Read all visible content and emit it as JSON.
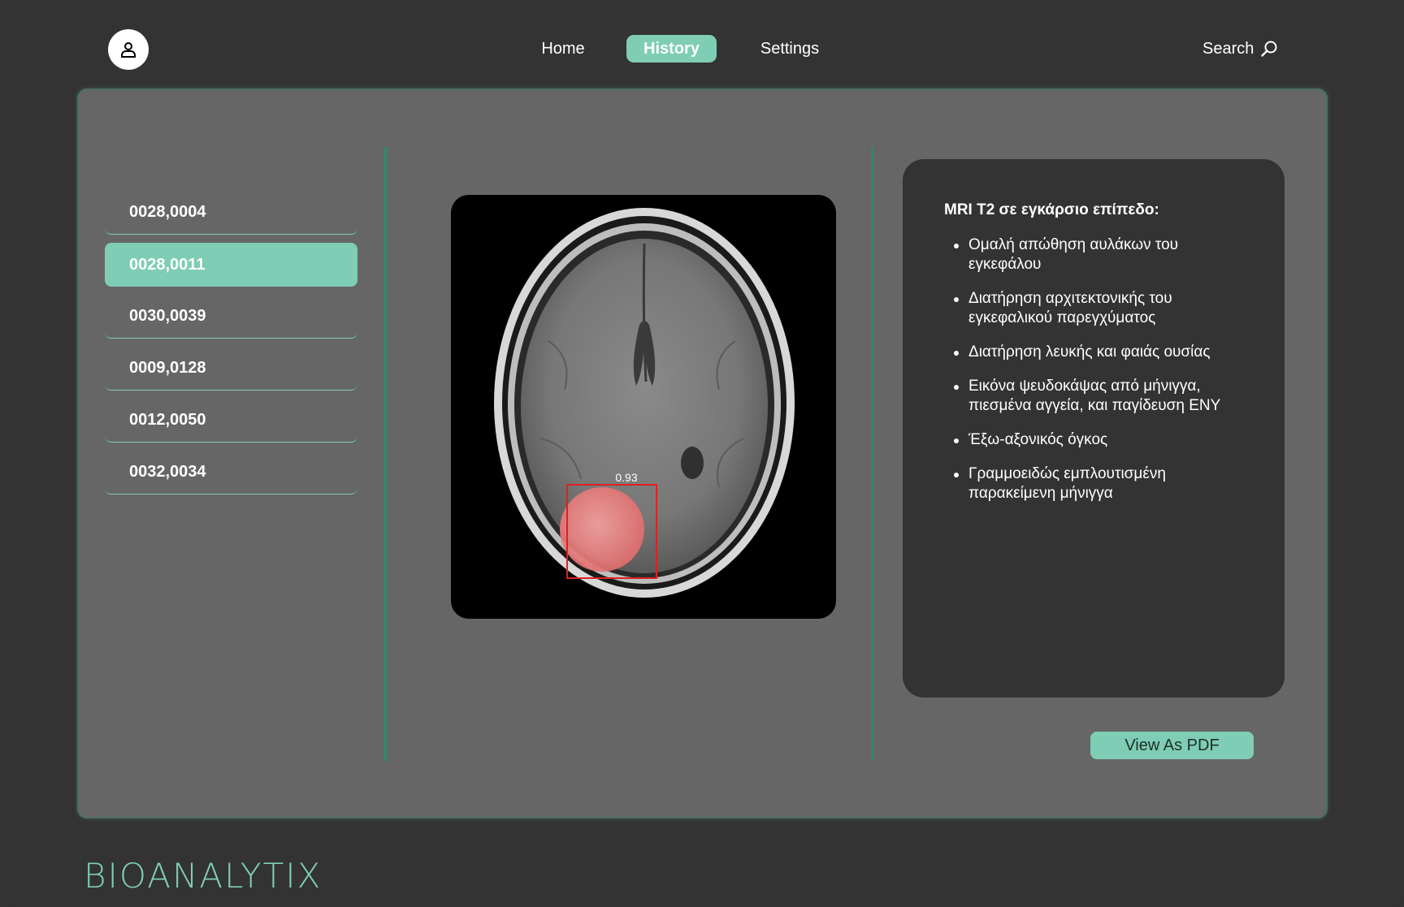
{
  "brand": {
    "logo_text": "BIOANALYTIX",
    "accent": "#7ecdb4"
  },
  "header": {
    "nav": [
      {
        "label": "Home",
        "active": false
      },
      {
        "label": "History",
        "active": true
      },
      {
        "label": "Settings",
        "active": false
      }
    ],
    "search_label": "Search",
    "icons": {
      "avatar": "user-icon",
      "search": "search-icon"
    }
  },
  "records": [
    {
      "label": "0028,0004",
      "selected": false
    },
    {
      "label": "0028,0011",
      "selected": true
    },
    {
      "label": "0030,0039",
      "selected": false
    },
    {
      "label": "0009,0128",
      "selected": false
    },
    {
      "label": "0012,0050",
      "selected": false
    },
    {
      "label": "0032,0034",
      "selected": false
    }
  ],
  "detection": {
    "confidence_label": "0.93",
    "box_color": "#e02020"
  },
  "report": {
    "title": "MRI T2 σε εγκάρσιο επίπεδο:",
    "findings": [
      "Ομαλή απώθηση αυλάκων του εγκεφάλου",
      "Διατήρηση αρχιτεκτονικής του εγκεφαλικού παρεγχύματος",
      "Διατήρηση λευκής και φαιάς ουσίας",
      "Εικόνα ψευδοκάψας από μήνιγγα, πιεσμένα αγγεία, και παγίδευση ΕΝΥ",
      "Έξω-αξονικός όγκος",
      "Γραμμοειδώς εμπλουτισμένη παρακείμενη μήνιγγα"
    ]
  },
  "actions": {
    "view_pdf_label": "View As PDF"
  }
}
